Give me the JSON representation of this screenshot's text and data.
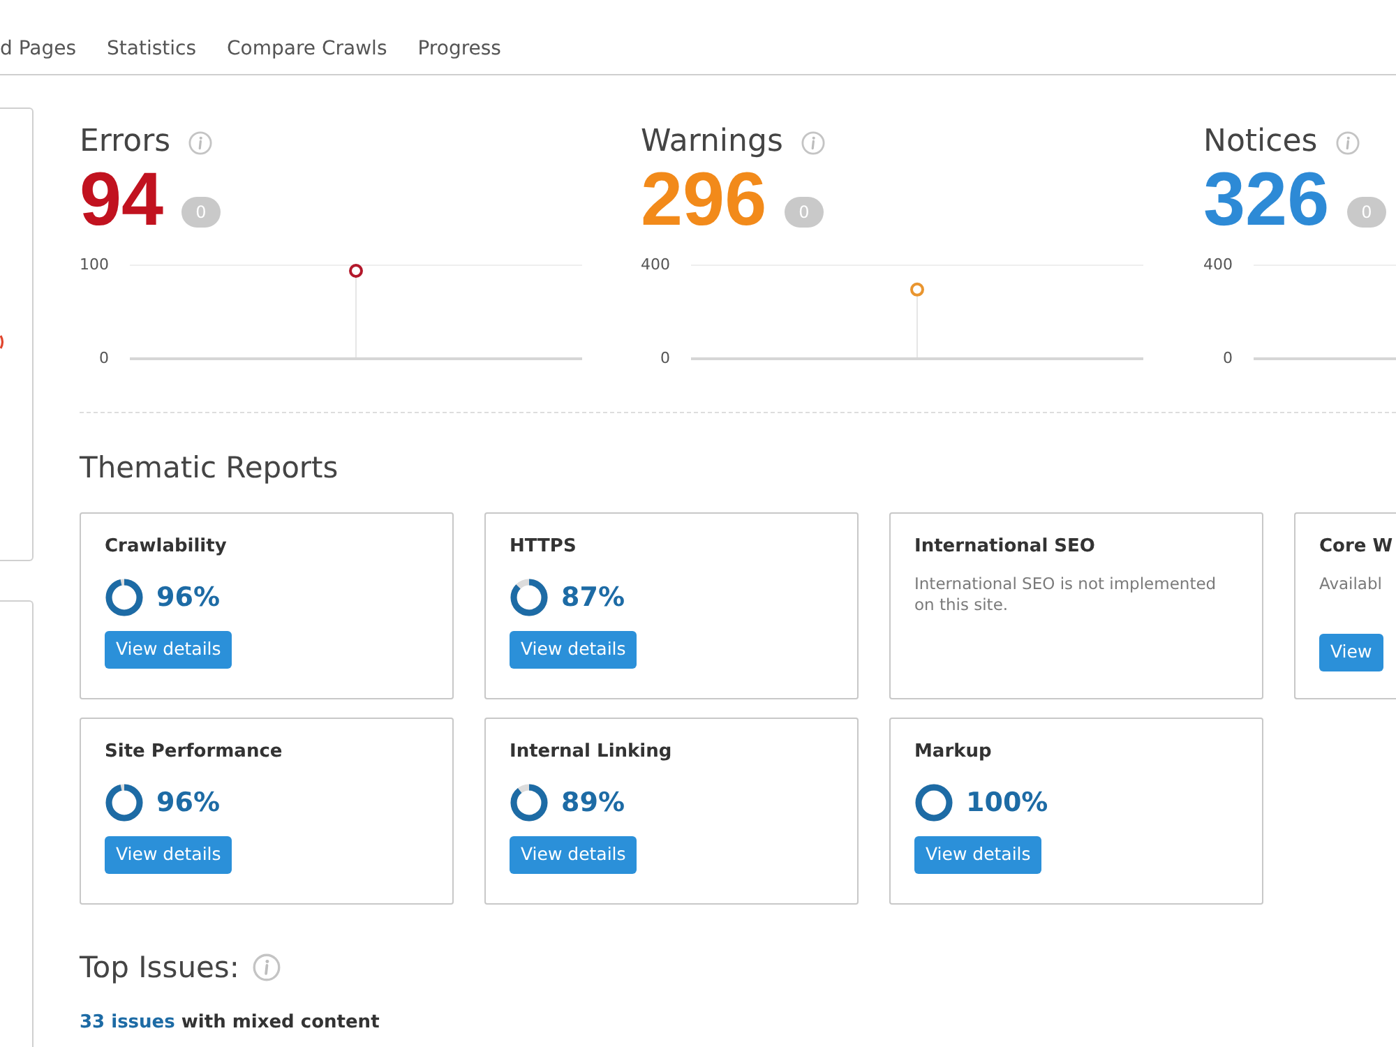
{
  "tabs": [
    "d Pages",
    "Statistics",
    "Compare Crawls",
    "Progress"
  ],
  "stats": [
    {
      "title": "Errors",
      "count": "94",
      "color": "#c1121f",
      "badge": "0",
      "chart_data": {
        "type": "line",
        "categories": [
          null
        ],
        "ylim": [
          0,
          100
        ],
        "yticks": [
          0,
          100
        ],
        "series": [
          {
            "color": "#b3182b",
            "marker": true,
            "values": [
              94
            ]
          }
        ]
      }
    },
    {
      "title": "Warnings",
      "count": "296",
      "color": "#f28a1a",
      "badge": "0",
      "chart_data": {
        "type": "line",
        "categories": [
          null
        ],
        "ylim": [
          0,
          400
        ],
        "yticks": [
          0,
          400
        ],
        "series": [
          {
            "color": "#e9952f",
            "marker": true,
            "values": [
              296
            ]
          }
        ]
      }
    },
    {
      "title": "Notices",
      "count": "326",
      "color": "#2d8ad6",
      "badge": "0",
      "axis_labels": [
        "400",
        "0"
      ]
    }
  ],
  "thematic_reports": {
    "title": "Thematic Reports",
    "cards": [
      {
        "kind": "score",
        "title": "Crawlability",
        "level": 0.96,
        "percent": "96%",
        "button": "View details"
      },
      {
        "kind": "score",
        "title": "HTTPS",
        "level": 0.87,
        "percent": "87%",
        "button": "View details"
      },
      {
        "kind": "note",
        "title": "International SEO",
        "description": "International SEO is not implemented on this site."
      },
      {
        "kind": "note",
        "title": "Core W",
        "description": "Availabl",
        "button": "View"
      },
      {
        "kind": "score",
        "title": "Site Performance",
        "level": 0.96,
        "percent": "96%",
        "button": "View details"
      },
      {
        "kind": "score",
        "title": "Internal Linking",
        "level": 0.89,
        "percent": "89%",
        "button": "View details"
      },
      {
        "kind": "score",
        "title": "Markup",
        "level": 1,
        "percent": "100%",
        "button": "View details"
      }
    ]
  },
  "top_issues": {
    "title": "Top Issues:",
    "items": [
      {
        "link": "33 issues",
        "text": "with mixed content"
      }
    ]
  }
}
